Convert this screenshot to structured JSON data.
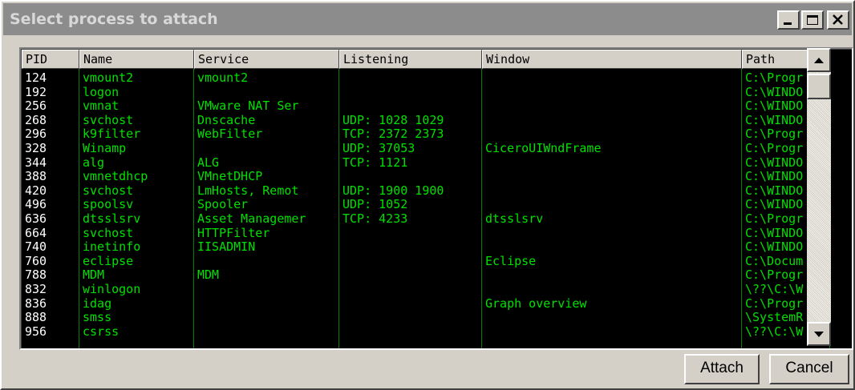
{
  "window": {
    "title": "Select process to attach"
  },
  "titlebar_buttons": [
    "minimize",
    "maximize",
    "close"
  ],
  "columns": [
    {
      "key": "pid",
      "label": "PID"
    },
    {
      "key": "name",
      "label": "Name"
    },
    {
      "key": "service",
      "label": "Service"
    },
    {
      "key": "listening",
      "label": "Listening"
    },
    {
      "key": "window",
      "label": "Window"
    },
    {
      "key": "path",
      "label": "Path"
    }
  ],
  "rows": [
    {
      "pid": "124",
      "name": "vmount2",
      "service": "vmount2",
      "listening": "",
      "window": "",
      "path": "C:\\Progr"
    },
    {
      "pid": "192",
      "name": "logon",
      "service": "",
      "listening": "",
      "window": "",
      "path": "C:\\WINDO"
    },
    {
      "pid": "256",
      "name": "vmnat",
      "service": "VMware NAT Ser",
      "listening": "",
      "window": "",
      "path": "C:\\WINDO"
    },
    {
      "pid": "268",
      "name": "svchost",
      "service": "Dnscache",
      "listening": "UDP: 1028 1029",
      "window": "",
      "path": "C:\\WINDO"
    },
    {
      "pid": "296",
      "name": "k9filter",
      "service": "WebFilter",
      "listening": "TCP: 2372 2373",
      "window": "",
      "path": "C:\\Progr"
    },
    {
      "pid": "328",
      "name": "Winamp",
      "service": "",
      "listening": "UDP: 37053",
      "window": "CiceroUIWndFrame",
      "path": "C:\\Progr"
    },
    {
      "pid": "344",
      "name": "alg",
      "service": "ALG",
      "listening": "TCP: 1121",
      "window": "",
      "path": "C:\\WINDO"
    },
    {
      "pid": "388",
      "name": "vmnetdhcp",
      "service": "VMnetDHCP",
      "listening": "",
      "window": "",
      "path": "C:\\WINDO"
    },
    {
      "pid": "420",
      "name": "svchost",
      "service": "LmHosts, Remot",
      "listening": "UDP: 1900 1900",
      "window": "",
      "path": "C:\\WINDO"
    },
    {
      "pid": "496",
      "name": "spoolsv",
      "service": "Spooler",
      "listening": "UDP: 1052",
      "window": "",
      "path": "C:\\WINDO"
    },
    {
      "pid": "636",
      "name": "dtsslsrv",
      "service": "Asset Managemer",
      "listening": "TCP: 4233",
      "window": "dtsslsrv",
      "path": "C:\\Progr"
    },
    {
      "pid": "664",
      "name": "svchost",
      "service": "HTTPFilter",
      "listening": "",
      "window": "",
      "path": "C:\\WINDO"
    },
    {
      "pid": "740",
      "name": "inetinfo",
      "service": "IISADMIN",
      "listening": "",
      "window": "",
      "path": "C:\\WINDO"
    },
    {
      "pid": "760",
      "name": "eclipse",
      "service": "",
      "listening": "",
      "window": "Eclipse",
      "path": "C:\\Docum"
    },
    {
      "pid": "788",
      "name": "MDM",
      "service": "MDM",
      "listening": "",
      "window": "",
      "path": "C:\\Progr"
    },
    {
      "pid": "832",
      "name": "winlogon",
      "service": "",
      "listening": "",
      "window": "",
      "path": "\\??\\C:\\W"
    },
    {
      "pid": "836",
      "name": "idag",
      "service": "",
      "listening": "",
      "window": "Graph overview",
      "path": "C:\\Progr"
    },
    {
      "pid": "888",
      "name": "smss",
      "service": "",
      "listening": "",
      "window": "",
      "path": "\\SystemR"
    },
    {
      "pid": "956",
      "name": "csrss",
      "service": "",
      "listening": "",
      "window": "",
      "path": "\\??\\C:\\W"
    }
  ],
  "buttons": {
    "attach": "Attach",
    "cancel": "Cancel"
  },
  "icons": {
    "scroll_up": "scroll-up-icon",
    "scroll_down": "scroll-down-icon"
  },
  "colors": {
    "list_bg": "#000000",
    "list_text": "#00e000",
    "pid_text": "#ffffff",
    "dialog_bg": "#d4d0c8",
    "titlebar": "#8c8c8c"
  }
}
